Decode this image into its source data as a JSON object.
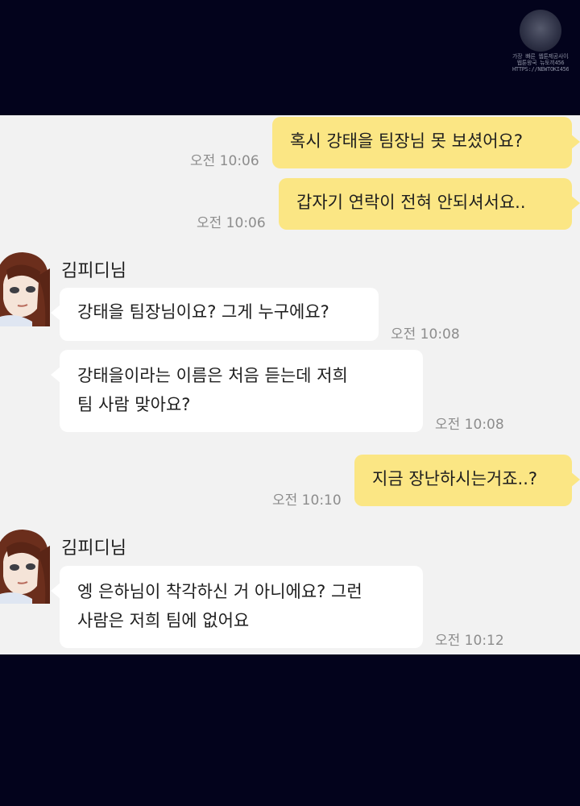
{
  "chat": {
    "messages": [
      {
        "side": "me",
        "text": "혹시 강태을 팀장님 못 보셨어요?",
        "time": "오전 10:06"
      },
      {
        "side": "me",
        "text": "갑자기 연락이 전혀 안되셔서요..",
        "time": "오전 10:06"
      },
      {
        "side": "them",
        "sender": "김피디님",
        "text": "강태을 팀장님이요? 그게 누구에요?",
        "time": "오전 10:08"
      },
      {
        "side": "them",
        "lines": [
          "강태을이라는 이름은 처음 듣는데 저희",
          "팀 사람 맞아요?"
        ],
        "time": "오전 10:08"
      },
      {
        "side": "me",
        "text": "지금 장난하시는거죠..?",
        "time": "오전 10:10"
      },
      {
        "side": "them",
        "sender": "김피디님",
        "lines": [
          "엥 은하님이 착각하신 거 아니에요? 그런",
          "사람은 저희 팀에 없어요"
        ],
        "time": "오전 10:12"
      }
    ]
  },
  "colors": {
    "background": "#03031c",
    "chat_background": "#f2f2f2",
    "my_bubble": "#fbe684",
    "their_bubble": "#ffffff",
    "timestamp": "#8d8d8d"
  },
  "watermark": {
    "icon": "site-logo",
    "lines": [
      "가장 빠른 웹툰제공사이트",
      "웹툰왕국 뉴토끼456",
      "HTTPS://NEWTOKI456.COM"
    ]
  }
}
